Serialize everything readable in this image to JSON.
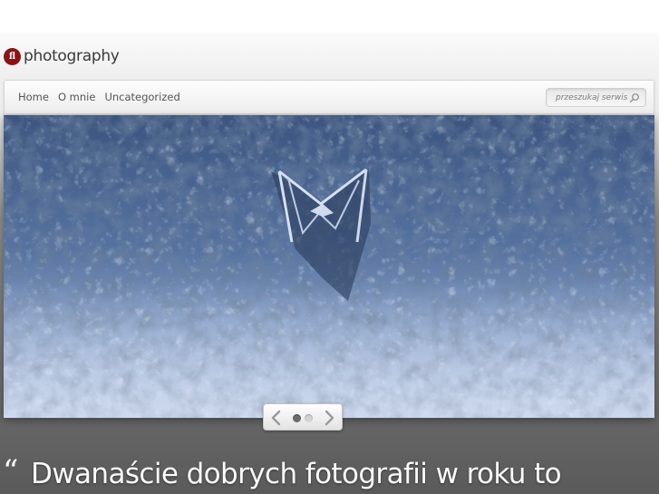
{
  "brand": {
    "logo_text": "photography",
    "logo_mark": "fl",
    "accent_color": "#8e1212"
  },
  "nav": {
    "items": [
      {
        "label": "Home"
      },
      {
        "label": "O mnie"
      },
      {
        "label": "Uncategorized"
      }
    ]
  },
  "search": {
    "placeholder": "przeszukaj serwis",
    "icon": "search-icon"
  },
  "slider": {
    "slide_image": "frozen-car-emblem-photo",
    "dots": 2,
    "active_dot": 1,
    "prev_icon": "chevron-left-icon",
    "next_icon": "chevron-right-icon"
  },
  "quote": {
    "mark": "“",
    "text": "Dwanaście dobrych fotografii w roku to"
  }
}
